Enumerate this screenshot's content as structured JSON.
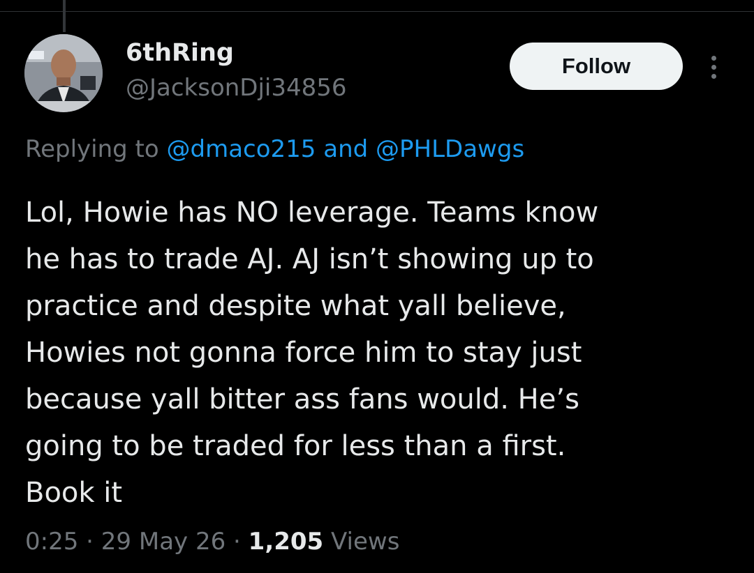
{
  "author": {
    "display_name": "6thRing",
    "handle": "@JacksonDji34856"
  },
  "actions": {
    "follow_label": "Follow"
  },
  "reply": {
    "prefix": "Replying to",
    "mention_1": "@dmaco215",
    "conjunction": "and",
    "mention_2": "@PHLDawgs"
  },
  "tweet": {
    "lines": [
      "Lol, Howie has NO leverage. Teams know",
      "he has to trade AJ. AJ isn’t showing up to",
      "practice and despite what yall believe,",
      "Howies not gonna force him to stay just",
      "because yall bitter ass fans would. He’s",
      "going to be traded for less than a first.",
      "Book it"
    ]
  },
  "meta": {
    "time": "0:25",
    "date": "29 May 26",
    "views_count": "1,205",
    "views_label": "Views",
    "separator": "·"
  },
  "icons": {
    "more": "more-horizontal-icon"
  },
  "colors": {
    "background": "#000000",
    "primary_text": "#e7e9ea",
    "secondary_text": "#71767b",
    "link": "#1d9bf0",
    "follow_bg": "#eff3f4"
  }
}
